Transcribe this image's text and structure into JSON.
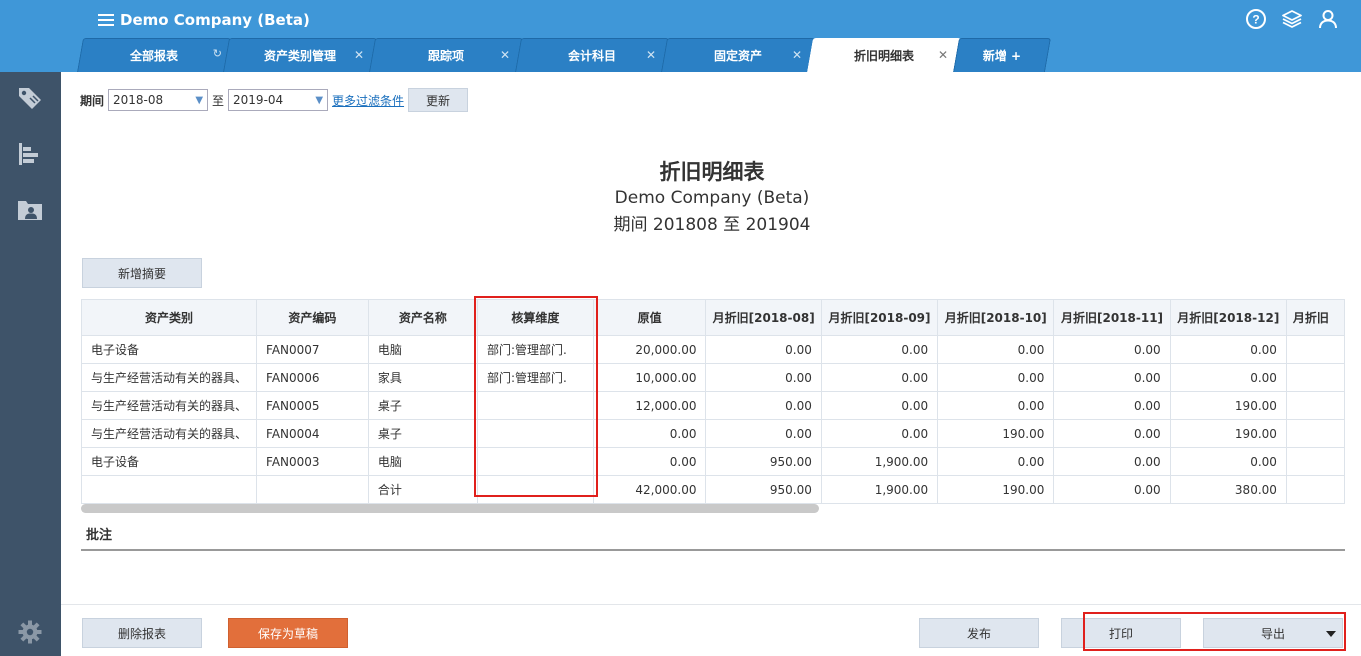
{
  "header": {
    "company": "Demo Company (Beta)",
    "icons": [
      "help-icon",
      "layers-icon",
      "user-icon"
    ]
  },
  "tabs": [
    {
      "label": "全部报表",
      "close": "↻"
    },
    {
      "label": "资产类别管理",
      "close": "✕"
    },
    {
      "label": "跟踪项",
      "close": "✕"
    },
    {
      "label": "会计科目",
      "close": "✕"
    },
    {
      "label": "固定资产",
      "close": "✕"
    },
    {
      "label": "折旧明细表",
      "close": "✕"
    },
    {
      "label": "新增 +",
      "close": ""
    }
  ],
  "sidebar": [
    "tag-icon",
    "chart-icon",
    "folder-icon",
    "settings-icon"
  ],
  "filter": {
    "period_label": "期间",
    "from": "2018-08",
    "to_label": "至",
    "to": "2019-04",
    "more_filters": "更多过滤条件",
    "refresh": "更新"
  },
  "report": {
    "title": "折旧明细表",
    "company": "Demo Company (Beta)",
    "period": "期间 201808 至 201904"
  },
  "add_summary": "新增摘要",
  "table": {
    "headers": [
      "资产类别",
      "资产编码",
      "资产名称",
      "核算维度",
      "原值",
      "月折旧[2018-08]",
      "月折旧[2018-09]",
      "月折旧[2018-10]",
      "月折旧[2018-11]",
      "月折旧[2018-12]",
      "月折旧"
    ],
    "rows": [
      [
        "电子设备",
        "FAN0007",
        "电脑",
        "部门:管理部门.",
        "20,000.00",
        "0.00",
        "0.00",
        "0.00",
        "0.00",
        "0.00",
        ""
      ],
      [
        "与生产经营活动有关的器具、",
        "FAN0006",
        "家具",
        "部门:管理部门.",
        "10,000.00",
        "0.00",
        "0.00",
        "0.00",
        "0.00",
        "0.00",
        ""
      ],
      [
        "与生产经营活动有关的器具、",
        "FAN0005",
        "桌子",
        "",
        "12,000.00",
        "0.00",
        "0.00",
        "0.00",
        "0.00",
        "190.00",
        ""
      ],
      [
        "与生产经营活动有关的器具、",
        "FAN0004",
        "桌子",
        "",
        "0.00",
        "0.00",
        "0.00",
        "190.00",
        "0.00",
        "190.00",
        ""
      ],
      [
        "电子设备",
        "FAN0003",
        "电脑",
        "",
        "0.00",
        "950.00",
        "1,900.00",
        "0.00",
        "0.00",
        "0.00",
        ""
      ],
      [
        "",
        "",
        "合计",
        "",
        "42,000.00",
        "950.00",
        "1,900.00",
        "190.00",
        "0.00",
        "380.00",
        ""
      ]
    ]
  },
  "remarks_label": "批注",
  "footer": {
    "delete": "删除报表",
    "save_draft": "保存为草稿",
    "publish": "发布",
    "print": "打印",
    "export": "导出"
  }
}
